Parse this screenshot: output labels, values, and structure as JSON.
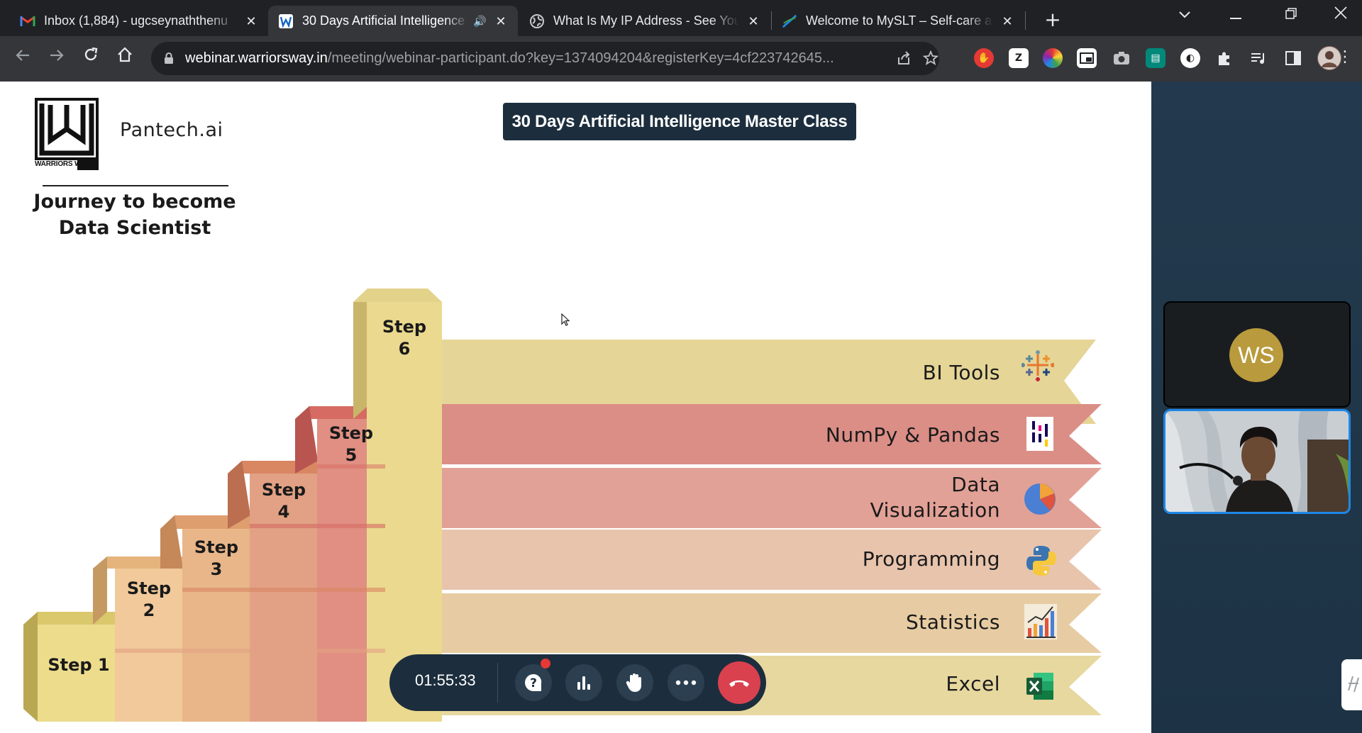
{
  "browser": {
    "tabs": [
      {
        "title": "Inbox (1,884) - ugcseynaththenu",
        "favicon": "gmail-icon",
        "active": false
      },
      {
        "title": "30 Days Artificial Intelligence",
        "favicon": "warriorsway-icon",
        "active": true,
        "audio": true
      },
      {
        "title": "What Is My IP Address - See You",
        "favicon": "globe-icon",
        "active": false
      },
      {
        "title": "Welcome to MySLT – Self-care a",
        "favicon": "slt-icon",
        "active": false
      }
    ],
    "url_host": "webinar.warriorsway.in",
    "url_path": "/meeting/webinar-participant.do?key=1374094204&registerKey=4cf223742645...",
    "accent": "#35363a"
  },
  "slide": {
    "brand": "Pantech.ai",
    "logo_text": "WARRIORS WAY",
    "journey_line1": "Journey to become",
    "journey_line2": "Data Scientist",
    "title": "30 Days Artificial Intelligence Master Class",
    "steps": [
      {
        "line1": "Step 1",
        "line2": ""
      },
      {
        "line1": "Step",
        "line2": "2"
      },
      {
        "line1": "Step",
        "line2": "3"
      },
      {
        "line1": "Step",
        "line2": "4"
      },
      {
        "line1": "Step",
        "line2": "5"
      },
      {
        "line1": "Step",
        "line2": "6"
      }
    ],
    "bands": [
      {
        "line1": "BI Tools",
        "line2": "",
        "icon": "tableau-icon",
        "color": "#e5d596"
      },
      {
        "line1": "NumPy & Pandas",
        "line2": "",
        "icon": "pandas-icon",
        "color": "#db8e86"
      },
      {
        "line1": "Data",
        "line2": "Visualization",
        "icon": "pie-chart-icon",
        "color": "#e2a196"
      },
      {
        "line1": "Programming",
        "line2": "",
        "icon": "python-icon",
        "color": "#e8c4ad"
      },
      {
        "line1": "Statistics",
        "line2": "",
        "icon": "bar-chart-icon",
        "color": "#e7cca3"
      },
      {
        "line1": "Excel",
        "line2": "",
        "icon": "excel-icon",
        "color": "#e7d8a0"
      }
    ]
  },
  "meeting": {
    "timer": "01:55:33",
    "controls": [
      "qa-icon",
      "poll-icon",
      "raise-hand-icon",
      "more-icon",
      "end-call-icon"
    ],
    "participant_initials": "WS",
    "end_color": "#d9414f"
  }
}
